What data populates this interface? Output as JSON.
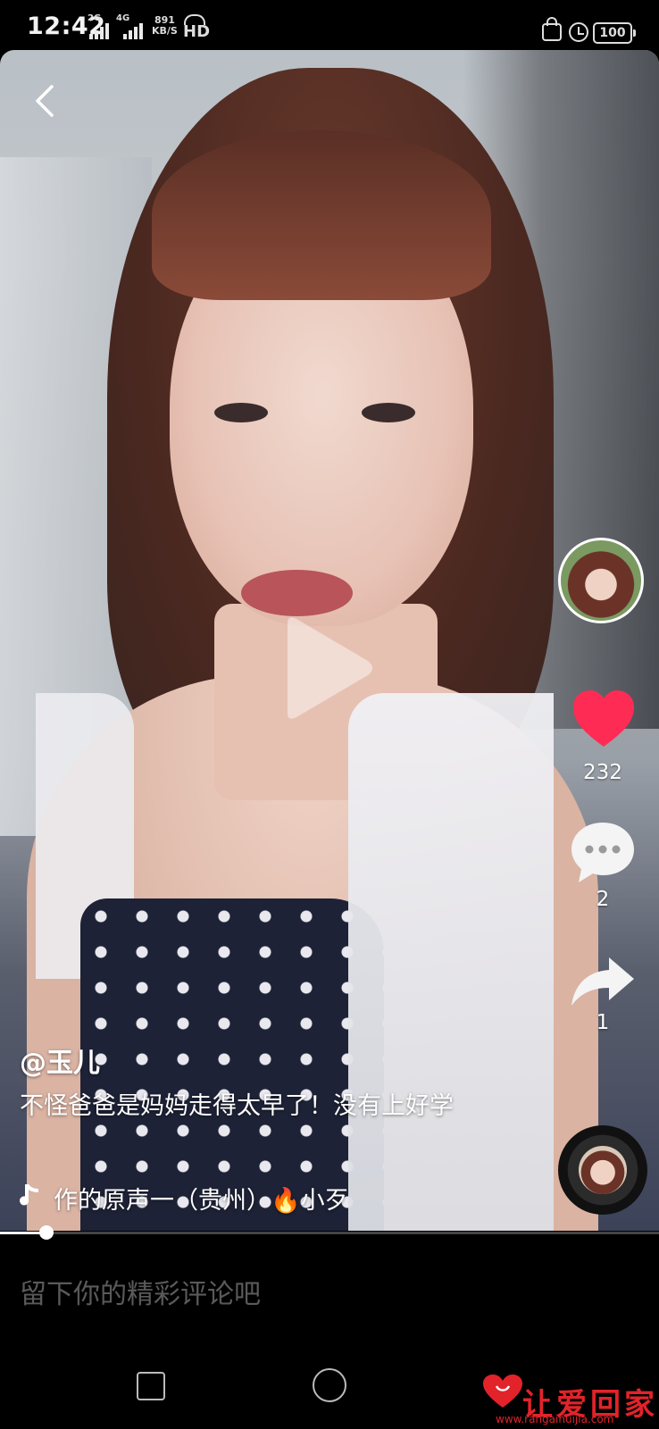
{
  "status_bar": {
    "time": "12:42",
    "sim1": "2G",
    "sim2": "4G",
    "net_speed": "891",
    "net_unit": "KB/S",
    "hd_label": "HD",
    "battery": "100"
  },
  "video": {
    "author": "@玉儿",
    "description": "不怪爸爸是妈妈走得太早了！没有上好学",
    "music": "作的原声一（贵州）🔥小歹",
    "progress": 0.07
  },
  "actions": {
    "likes": "232",
    "comments": "2",
    "shares": "1"
  },
  "comment_bar": {
    "placeholder": "留下你的精彩评论吧"
  },
  "watermark": {
    "text": "让爱回家",
    "url": "www.rangaihuijia.com"
  },
  "colors": {
    "like": "#fe2c55",
    "watermark": "#e2232a"
  }
}
